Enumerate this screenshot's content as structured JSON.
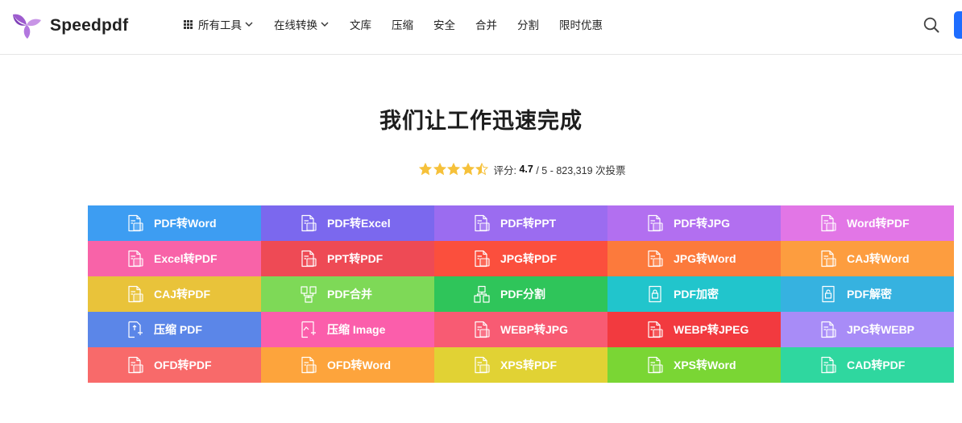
{
  "header": {
    "brand": "Speedpdf",
    "nav": [
      {
        "label": "所有工具",
        "has_grid_icon": true,
        "has_dropdown": true
      },
      {
        "label": "在线转换",
        "has_grid_icon": false,
        "has_dropdown": true
      },
      {
        "label": "文库",
        "has_grid_icon": false,
        "has_dropdown": false
      },
      {
        "label": "压缩",
        "has_grid_icon": false,
        "has_dropdown": false
      },
      {
        "label": "安全",
        "has_grid_icon": false,
        "has_dropdown": false
      },
      {
        "label": "合并",
        "has_grid_icon": false,
        "has_dropdown": false
      },
      {
        "label": "分割",
        "has_grid_icon": false,
        "has_dropdown": false
      },
      {
        "label": "限时优惠",
        "has_grid_icon": false,
        "has_dropdown": false
      }
    ],
    "search_icon": "search-icon",
    "accent": "#1e6dff"
  },
  "hero": {
    "title": "我们让工作迅速完成",
    "rating": {
      "stars": 4.5,
      "max_stars": 5,
      "prefix": "评分:",
      "score": "4.7",
      "rest": "/ 5 - 823,319 次投票",
      "star_color": "#f6c13a"
    }
  },
  "tools": [
    {
      "label": "PDF转Word",
      "color": "#3d9df2",
      "icon": "pdf-doc-icon"
    },
    {
      "label": "PDF转Excel",
      "color": "#7b68ee",
      "icon": "pdf-doc-icon"
    },
    {
      "label": "PDF转PPT",
      "color": "#9b6cf0",
      "icon": "pdf-doc-icon"
    },
    {
      "label": "PDF转JPG",
      "color": "#b26ff0",
      "icon": "pdf-doc-icon"
    },
    {
      "label": "Word转PDF",
      "color": "#e276e6",
      "icon": "word-doc-icon"
    },
    {
      "label": "Excel转PDF",
      "color": "#f863a8",
      "icon": "excel-doc-icon"
    },
    {
      "label": "PPT转PDF",
      "color": "#ee4a55",
      "icon": "ppt-doc-icon"
    },
    {
      "label": "JPG转PDF",
      "color": "#fb4f3d",
      "icon": "image-doc-icon"
    },
    {
      "label": "JPG转Word",
      "color": "#fc7a3c",
      "icon": "image-doc-icon"
    },
    {
      "label": "CAJ转Word",
      "color": "#fd9d3f",
      "icon": "caj-doc-icon"
    },
    {
      "label": "CAJ转PDF",
      "color": "#e9c33a",
      "icon": "caj-doc-icon"
    },
    {
      "label": "PDF合并",
      "color": "#7ed957",
      "icon": "merge-icon"
    },
    {
      "label": "PDF分割",
      "color": "#2fc55a",
      "icon": "split-icon"
    },
    {
      "label": "PDF加密",
      "color": "#21c5cc",
      "icon": "lock-icon"
    },
    {
      "label": "PDF解密",
      "color": "#36b2e0",
      "icon": "unlock-icon"
    },
    {
      "label": "压缩 PDF",
      "color": "#5b86e8",
      "icon": "compress-icon"
    },
    {
      "label": "压缩 Image",
      "color": "#fb5eab",
      "icon": "compress-image-icon"
    },
    {
      "label": "WEBP转JPG",
      "color": "#f85b73",
      "icon": "image-doc-icon"
    },
    {
      "label": "WEBP转JPEG",
      "color": "#f23a3f",
      "icon": "image-doc-icon"
    },
    {
      "label": "JPG转WEBP",
      "color": "#a88cf7",
      "icon": "image-doc-icon"
    },
    {
      "label": "OFD转PDF",
      "color": "#f86a6a",
      "icon": "ofd-doc-icon"
    },
    {
      "label": "OFD转Word",
      "color": "#fda43c",
      "icon": "ofd-doc-icon"
    },
    {
      "label": "XPS转PDF",
      "color": "#e1d234",
      "icon": "xps-doc-icon"
    },
    {
      "label": "XPS转Word",
      "color": "#7ad634",
      "icon": "xps-doc-icon"
    },
    {
      "label": "CAD转PDF",
      "color": "#2fd79f",
      "icon": "cad-doc-icon"
    }
  ]
}
